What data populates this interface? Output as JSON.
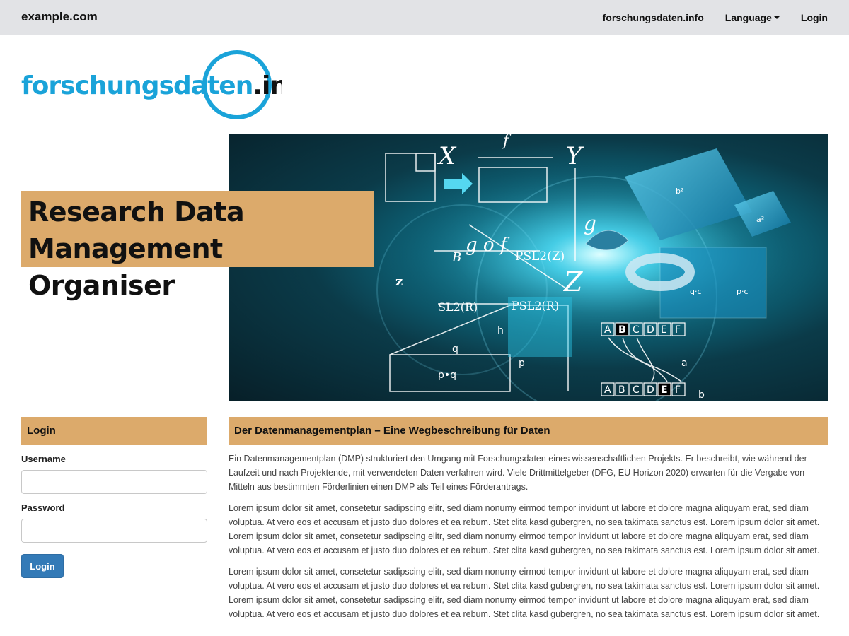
{
  "nav": {
    "brand": "example.com",
    "links": [
      "forschungsdaten.info",
      "Language",
      "Login"
    ]
  },
  "logo": {
    "text_main": "forschungsdaten",
    "text_suffix": ".info",
    "brand_color": "#1aa3d9"
  },
  "hero": {
    "title": "Research Data Management Organiser",
    "formula_labels": [
      "X",
      "f",
      "Y",
      "g",
      "Z",
      "g o f",
      "B",
      "PSL2(Z)",
      "z",
      "SL2(R)",
      "PSL2(R)",
      "h",
      "q",
      "p•q",
      "p",
      "a",
      "b",
      "a²",
      "b²",
      "p·c",
      "q·c"
    ],
    "letters_top": [
      "A",
      "B",
      "C",
      "D",
      "E",
      "F"
    ],
    "letters_bottom": [
      "A",
      "B",
      "C",
      "D",
      "E",
      "F"
    ]
  },
  "login": {
    "heading": "Login",
    "username_label": "Username",
    "username_value": "",
    "password_label": "Password",
    "password_value": "",
    "button": "Login"
  },
  "article": {
    "heading": "Der Datenmanagementplan – Eine Wegbeschreibung für Daten",
    "paragraphs": [
      "Ein Datenmanagementplan (DMP) strukturiert den Umgang mit Forschungsdaten eines wissenschaftlichen Projekts. Er beschreibt, wie während der Laufzeit und nach Projektende, mit verwendeten Daten verfahren wird. Viele Drittmittelgeber (DFG, EU Horizon 2020) erwarten für die Vergabe von Mitteln aus bestimmten Förderlinien einen DMP als Teil eines Förderantrags.",
      "Lorem ipsum dolor sit amet, consetetur sadipscing elitr, sed diam nonumy eirmod tempor invidunt ut labore et dolore magna aliquyam erat, sed diam voluptua. At vero eos et accusam et justo duo dolores et ea rebum. Stet clita kasd gubergren, no sea takimata sanctus est. Lorem ipsum dolor sit amet. Lorem ipsum dolor sit amet, consetetur sadipscing elitr, sed diam nonumy eirmod tempor invidunt ut labore et dolore magna aliquyam erat, sed diam voluptua. At vero eos et accusam et justo duo dolores et ea rebum. Stet clita kasd gubergren, no sea takimata sanctus est. Lorem ipsum dolor sit amet.",
      "Lorem ipsum dolor sit amet, consetetur sadipscing elitr, sed diam nonumy eirmod tempor invidunt ut labore et dolore magna aliquyam erat, sed diam voluptua. At vero eos et accusam et justo duo dolores et ea rebum. Stet clita kasd gubergren, no sea takimata sanctus est. Lorem ipsum dolor sit amet. Lorem ipsum dolor sit amet, consetetur sadipscing elitr, sed diam nonumy eirmod tempor invidunt ut labore et dolore magna aliquyam erat, sed diam voluptua. At vero eos et accusam et justo duo dolores et ea rebum. Stet clita kasd gubergren, no sea takimata sanctus est. Lorem ipsum dolor sit amet."
    ]
  },
  "colors": {
    "accent": "#dcaa6b",
    "topbar": "#e2e3e6",
    "button": "#337ab7",
    "logo_blue": "#1aa3d9"
  }
}
